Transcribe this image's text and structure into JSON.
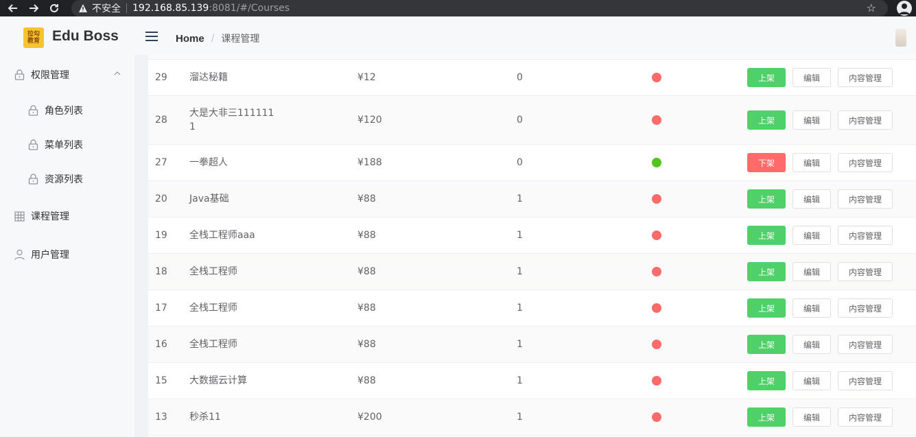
{
  "browser": {
    "insecure_label": "不安全",
    "url_host": "192.168.85.139",
    "url_rest": ":8081/#/Courses"
  },
  "header": {
    "logo_text": "拉勾\n教育",
    "app_title": "Edu Boss",
    "breadcrumb_home": "Home",
    "breadcrumb_sep": "/",
    "breadcrumb_current": "课程管理"
  },
  "sidebar": {
    "items": [
      {
        "label": "权限管理",
        "icon": "lock-icon",
        "expanded": true
      },
      {
        "label": "角色列表",
        "icon": "lock-icon"
      },
      {
        "label": "菜单列表",
        "icon": "lock-icon"
      },
      {
        "label": "资源列表",
        "icon": "lock-icon"
      },
      {
        "label": "课程管理",
        "icon": "grid-icon"
      },
      {
        "label": "用户管理",
        "icon": "user-icon"
      }
    ]
  },
  "colors": {
    "on_sale_dot": "#52c41a",
    "off_sale_dot": "#ff6b6b",
    "up_button": "#4fd069",
    "down_button": "#ff6b6b"
  },
  "buttons": {
    "up": "上架",
    "down": "下架",
    "edit": "编辑",
    "content": "内容管理"
  },
  "courses": [
    {
      "id": "29",
      "name": "溜达秘籍",
      "price": "¥12",
      "sales": "0",
      "on_sale": false
    },
    {
      "id": "28",
      "name": "大是大非三111111",
      "name2": "1",
      "price": "¥120",
      "sales": "0",
      "on_sale": false
    },
    {
      "id": "27",
      "name": "一拳超人",
      "price": "¥188",
      "sales": "0",
      "on_sale": true
    },
    {
      "id": "20",
      "name": "Java基础",
      "price": "¥88",
      "sales": "1",
      "on_sale": false
    },
    {
      "id": "19",
      "name": "全栈工程师aaa",
      "price": "¥88",
      "sales": "1",
      "on_sale": false
    },
    {
      "id": "18",
      "name": "全栈工程师",
      "price": "¥88",
      "sales": "1",
      "on_sale": false
    },
    {
      "id": "17",
      "name": "全栈工程师",
      "price": "¥88",
      "sales": "1",
      "on_sale": false
    },
    {
      "id": "16",
      "name": "全栈工程师",
      "price": "¥88",
      "sales": "1",
      "on_sale": false
    },
    {
      "id": "15",
      "name": "大数据云计算",
      "price": "¥88",
      "sales": "1",
      "on_sale": false
    },
    {
      "id": "13",
      "name": "秒杀11",
      "price": "¥200",
      "sales": "1",
      "on_sale": false
    }
  ]
}
